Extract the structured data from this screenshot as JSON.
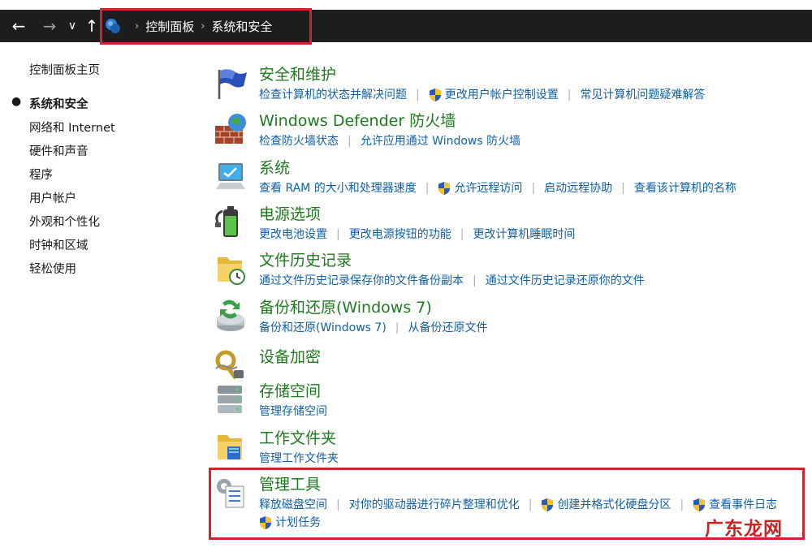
{
  "nav": {
    "back_icon": "back-arrow-icon",
    "forward_icon": "forward-arrow-icon",
    "recent_icon": "chevron-down-icon",
    "up_icon": "up-arrow-icon"
  },
  "address": {
    "crumbs": [
      "控制面板",
      "系统和安全"
    ]
  },
  "sidebar": {
    "items": [
      {
        "label": "控制面板主页"
      },
      {
        "label": "系统和安全"
      },
      {
        "label": "网络和 Internet"
      },
      {
        "label": "硬件和声音"
      },
      {
        "label": "程序"
      },
      {
        "label": "用户帐户"
      },
      {
        "label": "外观和个性化"
      },
      {
        "label": "时钟和区域"
      },
      {
        "label": "轻松使用"
      }
    ]
  },
  "categories": [
    {
      "title": "安全和维护",
      "icon": "flag-icon",
      "links": [
        "检查计算机的状态并解决问题",
        "更改用户帐户控制设置",
        "常见计算机问题疑难解答"
      ]
    },
    {
      "title": "Windows Defender 防火墙",
      "icon": "firewall-icon",
      "links": [
        "检查防火墙状态",
        "允许应用通过 Windows 防火墙"
      ]
    },
    {
      "title": "系统",
      "icon": "computer-icon",
      "links": [
        "查看 RAM 的大小和处理器速度",
        "允许远程访问",
        "启动远程协助",
        "查看该计算机的名称"
      ]
    },
    {
      "title": "电源选项",
      "icon": "battery-icon",
      "links": [
        "更改电池设置",
        "更改电源按钮的功能",
        "更改计算机睡眠时间"
      ]
    },
    {
      "title": "文件历史记录",
      "icon": "file-history-icon",
      "links": [
        "通过文件历史记录保存你的文件备份副本",
        "通过文件历史记录还原你的文件"
      ]
    },
    {
      "title": "备份和还原(Windows 7)",
      "icon": "backup-icon",
      "links": [
        "备份和还原(Windows 7)",
        "从备份还原文件"
      ]
    },
    {
      "title": "设备加密",
      "icon": "key-icon",
      "links": []
    },
    {
      "title": "存储空间",
      "icon": "storage-icon",
      "links": [
        "管理存储空间"
      ]
    },
    {
      "title": "工作文件夹",
      "icon": "work-folder-icon",
      "links": [
        "管理工作文件夹"
      ]
    },
    {
      "title": "管理工具",
      "icon": "admin-tools-icon",
      "links": [
        "释放磁盘空间",
        "对你的驱动器进行碎片整理和优化",
        "创建并格式化硬盘分区",
        "查看事件日志",
        "计划任务"
      ]
    }
  ],
  "watermark": "广东龙网",
  "colors": {
    "title_green": "#1e7a1e",
    "link_blue": "#1060a8",
    "highlight_red": "#d3232f",
    "address_bg": "#1d1d1d"
  }
}
